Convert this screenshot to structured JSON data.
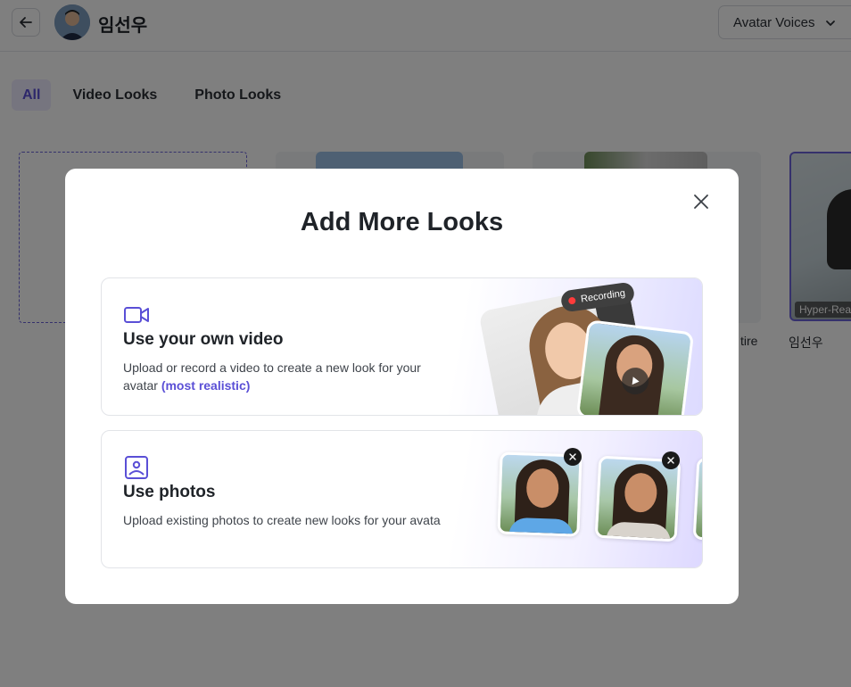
{
  "header": {
    "back_label": "Back",
    "avatar_name": "임선우",
    "voices_button": "Avatar Voices"
  },
  "tabs": [
    {
      "label": "All",
      "active": true
    },
    {
      "label": "Video Looks",
      "active": false
    },
    {
      "label": "Photo Looks",
      "active": false
    }
  ],
  "grid": {
    "partial_label_tile3": "tire",
    "selected_tile_label": "임선우",
    "selected_tile_tag": "Hyper-Rea"
  },
  "modal": {
    "title": "Add More Looks",
    "options": [
      {
        "title": "Use your own video",
        "description": "Upload or record a video to create a new look for your avatar",
        "highlight": "(most realistic)",
        "recording_badge": "Recording",
        "icon": "video-camera-icon"
      },
      {
        "title": "Use photos",
        "description": "Upload existing photos to create new looks for your avatar",
        "icon": "image-icon"
      }
    ]
  },
  "colors": {
    "accent": "#5a4fd6",
    "overlay": "rgba(0,0,0,0.5)",
    "text": "#1f2328"
  }
}
